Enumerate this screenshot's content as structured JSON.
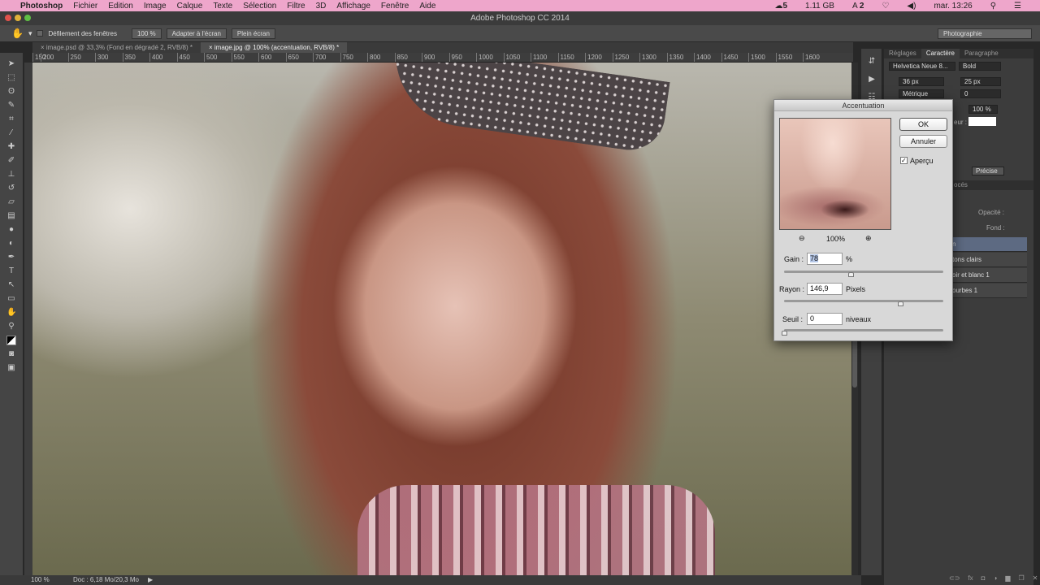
{
  "menubar": {
    "apple": "",
    "items": [
      "Photoshop",
      "Fichier",
      "Edition",
      "Image",
      "Calque",
      "Texte",
      "Sélection",
      "Filtre",
      "3D",
      "Affichage",
      "Fenêtre",
      "Aide"
    ],
    "status": {
      "notifications": "5",
      "memory": "1.11 GB",
      "adobe_count": "2",
      "clock": "mar. 13:26"
    }
  },
  "window": {
    "title": "Adobe Photoshop CC 2014"
  },
  "options": {
    "scroll_all": "Défilement des fenêtres",
    "zoom100": "100 %",
    "fit": "Adapter à l'écran",
    "fullscreen": "Plein écran",
    "workspace": "Photographie"
  },
  "tabs": [
    {
      "label": "image.psd @ 33,3% (Fond en dégradé 2, RVB/8) *"
    },
    {
      "label": "image.jpg @ 100% (accentuation, RVB/8) *",
      "active": true
    }
  ],
  "ruler": [
    "150",
    "200",
    "250",
    "300",
    "350",
    "400",
    "450",
    "500",
    "550",
    "600",
    "650",
    "700",
    "750",
    "800",
    "850",
    "900",
    "950",
    "1000",
    "1050",
    "1100",
    "1150",
    "1200",
    "1250",
    "1300",
    "1350",
    "1400",
    "1450",
    "1500",
    "1550",
    "1600"
  ],
  "status": {
    "zoom": "100 %",
    "doc": "Doc : 6,18 Mo/20,3 Mo"
  },
  "panel": {
    "tabs": [
      "Réglages",
      "Caractère",
      "Paragraphe"
    ],
    "font": "Helvetica Neue 8...",
    "style": "Bold",
    "size": "36 px",
    "leading": "25 px",
    "kerning": "Métrique",
    "tracking": "0",
    "hscale": "100 %",
    "color_label": "eur :",
    "aa": "Précise",
    "layers_title": "océs",
    "opacity_label": "Opacité :",
    "fill_label": "Fond :",
    "layers": [
      "n",
      "tons clairs",
      "oir et blanc 1",
      "ourbes 1"
    ]
  },
  "dialog": {
    "title": "Accentuation",
    "ok": "OK",
    "cancel": "Annuler",
    "preview_label": "Aperçu",
    "preview_checked": true,
    "zoom": "100%",
    "gain_label": "Gain :",
    "gain": "78",
    "gain_unit": "%",
    "gain_slider_pct": 42,
    "radius_label": "Rayon :",
    "radius": "146,9",
    "radius_unit": "Pixels",
    "radius_slider_pct": 73,
    "threshold_label": "Seuil :",
    "threshold": "0",
    "threshold_unit": "niveaux",
    "threshold_slider_pct": 0
  },
  "colors": {
    "menubar": "#eea6cb",
    "panel": "#3c3c3c",
    "dialog": "#d8d8d8"
  }
}
